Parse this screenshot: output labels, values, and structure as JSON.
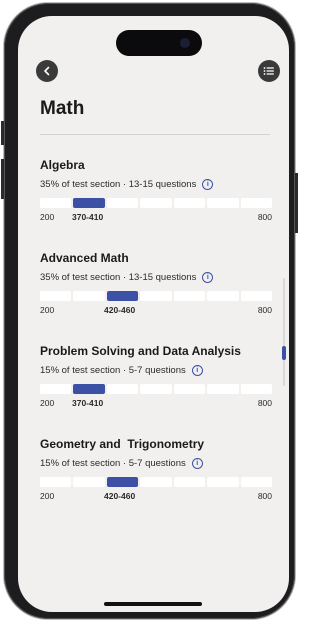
{
  "page": {
    "title": "Math"
  },
  "colors": {
    "accent": "#3c51a6",
    "background": "#f1f0ee",
    "segment_empty": "#ffffff"
  },
  "header": {
    "back_icon": "chevron-left-icon",
    "menu_icon": "list-icon"
  },
  "sections": [
    {
      "title": "Algebra",
      "subtitle": "35% of test section · 13-15 questions",
      "score_min": "200",
      "score_max": "800",
      "range_label": "370-410",
      "filled_segment": 1
    },
    {
      "title": "Advanced Math",
      "subtitle": "35% of test section · 13-15 questions",
      "score_min": "200",
      "score_max": "800",
      "range_label": "420-460",
      "filled_segment": 2
    },
    {
      "title": "Problem Solving and Data Analysis",
      "subtitle": "15% of test section · 5-7 questions",
      "score_min": "200",
      "score_max": "800",
      "range_label": "370-410",
      "filled_segment": 1
    },
    {
      "title": "Geometry and  Trigonometry",
      "subtitle": "15% of test section · 5-7 questions",
      "score_min": "200",
      "score_max": "800",
      "range_label": "420-460",
      "filled_segment": 2
    }
  ]
}
